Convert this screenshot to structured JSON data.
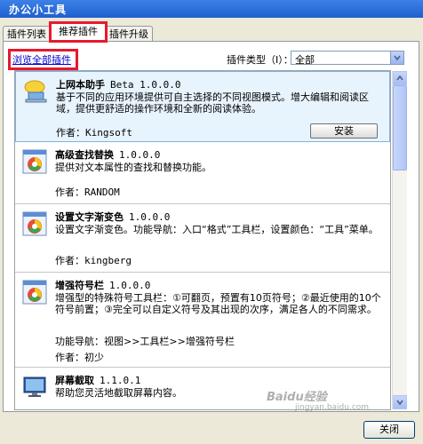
{
  "window": {
    "title": "办公小工具"
  },
  "tabs": [
    {
      "label": "插件列表"
    },
    {
      "label": "推荐插件"
    },
    {
      "label": "插件升级"
    }
  ],
  "toolbar": {
    "browse_all": "浏览全部插件",
    "type_label": "插件类型（I）：",
    "type_value": "全部"
  },
  "plugins": [
    {
      "name": "上网本助手",
      "version": "Beta 1.0.0.0",
      "description": "基于不同的应用环境提供可自主选择的不同视图模式。增大编辑和阅读区域，提供更舒适的操作环境和全新的阅读体验。",
      "author_label": "作者：",
      "author": "Kingsoft",
      "install_label": "安装"
    },
    {
      "name": "高级查找替换",
      "version": "1.0.0.0",
      "description": "提供对文本属性的查找和替换功能。",
      "author_label": "作者：",
      "author": "RANDOM"
    },
    {
      "name": "设置文字渐变色",
      "version": "1.0.0.0",
      "description": "设置文字渐变色。功能导航：入口“格式”工具栏，设置颜色：“工具”菜单。",
      "author_label": "作者：",
      "author": "kingberg"
    },
    {
      "name": "增强符号栏",
      "version": "1.0.0.0",
      "description": "增强型的特殊符号工具栏：①可翻页，预置有10页符号；②最近使用的10个符号前置；③完全可以自定义符号及其出现的次序，满足各人的不同需求。",
      "nav": "功能导航：视图>>工具栏>>增强符号栏",
      "author_label": "作者：",
      "author": "初少"
    },
    {
      "name": "屏幕截取",
      "version": "1.1.0.1",
      "description": "帮助您灵活地截取屏幕内容。"
    }
  ],
  "footer": {
    "close_label": "关闭"
  },
  "watermark": {
    "text": "Baidu经验",
    "sub": "jingyan.baidu.com"
  }
}
